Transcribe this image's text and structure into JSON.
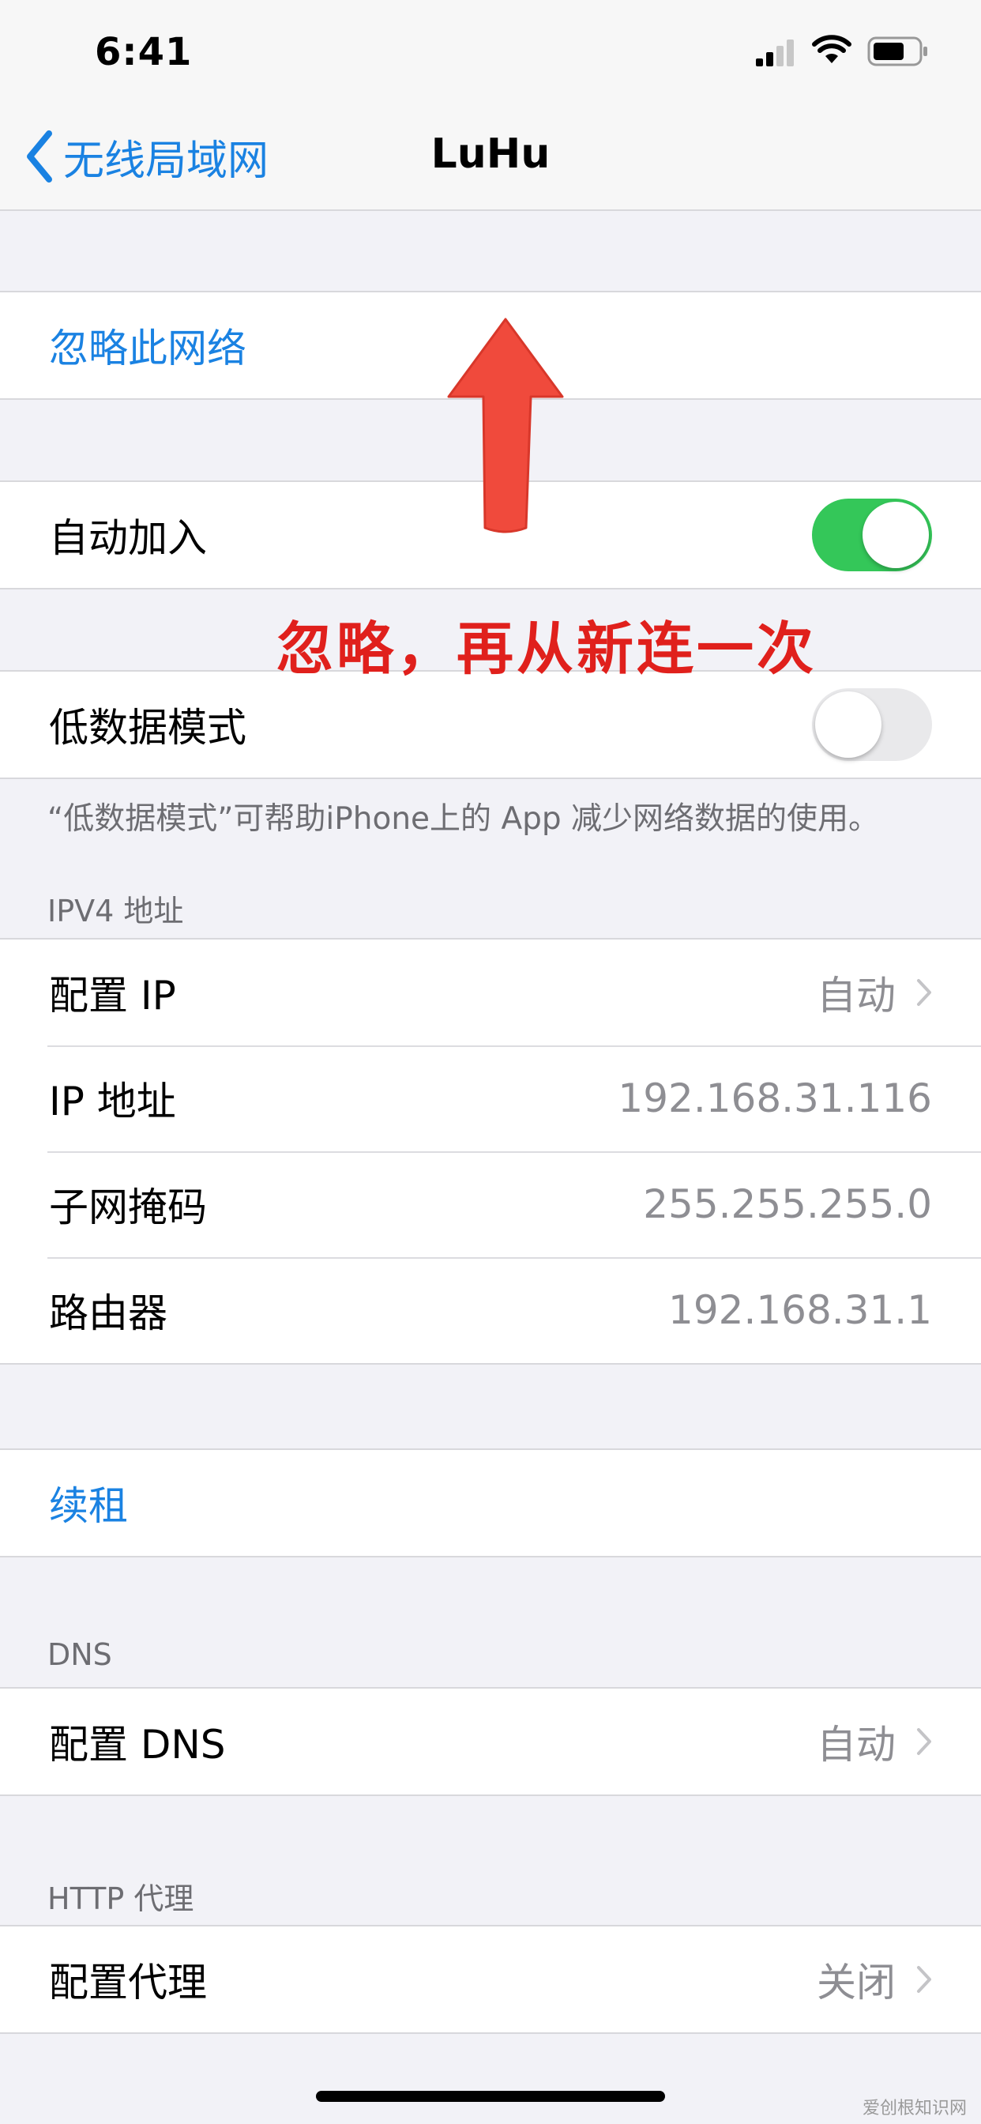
{
  "status_bar": {
    "time": "6:41",
    "signal_icon": "cellular-signal-icon",
    "wifi_icon": "wifi-icon",
    "battery_icon": "battery-icon"
  },
  "nav": {
    "back_label": "无线局域网",
    "title": "LuHu"
  },
  "forget": {
    "label": "忽略此网络"
  },
  "auto_join": {
    "label": "自动加入",
    "on": true
  },
  "annotation": {
    "text": "忽略，再从新连一次",
    "color": "#e0201c"
  },
  "low_data": {
    "label": "低数据模式",
    "on": false,
    "note": "“低数据模式”可帮助iPhone上的 App 减少网络数据的使用。"
  },
  "ipv4": {
    "header": "IPV4 地址",
    "configure_ip": {
      "label": "配置 IP",
      "value": "自动"
    },
    "ip_address": {
      "label": "IP 地址",
      "value": "192.168.31.116"
    },
    "subnet_mask": {
      "label": "子网掩码",
      "value": "255.255.255.0"
    },
    "router": {
      "label": "路由器",
      "value": "192.168.31.1"
    }
  },
  "renew": {
    "label": "续租"
  },
  "dns": {
    "header": "DNS",
    "label": "配置 DNS",
    "value": "自动"
  },
  "http_proxy": {
    "header": "HTTP 代理",
    "label": "配置代理",
    "value": "关闭"
  },
  "watermark": "爱创根知识网",
  "colors": {
    "accent": "#1a82e2",
    "toggle_on": "#34c759",
    "background": "#f2f2f7"
  }
}
